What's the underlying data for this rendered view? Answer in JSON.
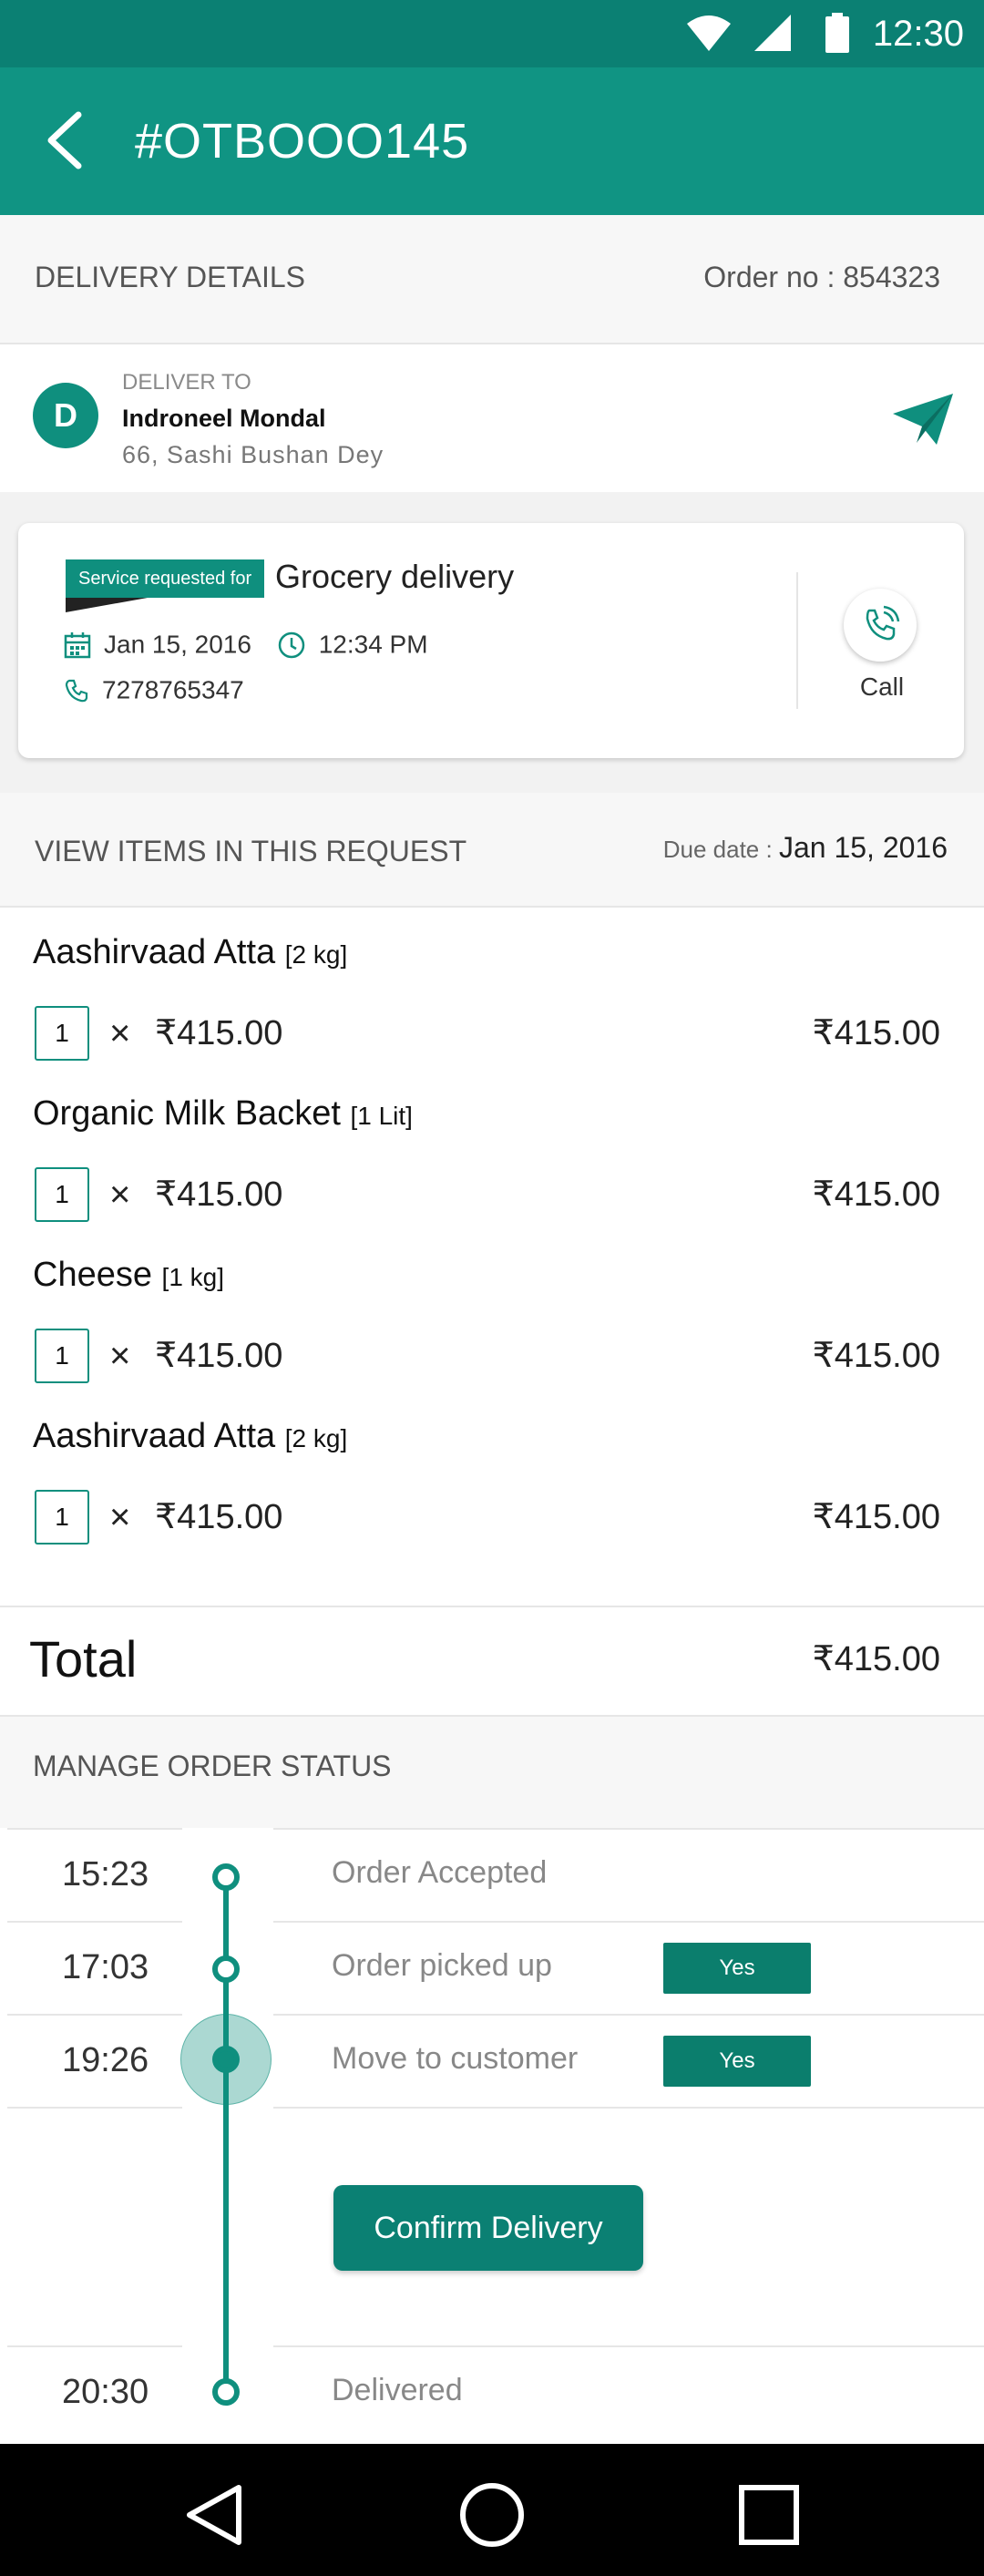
{
  "status_bar": {
    "time": "12:30"
  },
  "app_bar": {
    "title": "#OTBOOO145"
  },
  "delivery_section": {
    "title": "DELIVERY DETAILS",
    "order_no": "Order no : 854323"
  },
  "deliver_to": {
    "label": "DELIVER TO",
    "avatar_letter": "D",
    "name": "Indroneel Mondal",
    "address": "66, Sashi Bushan Dey"
  },
  "service_card": {
    "tag": "Service requested for",
    "service": "Grocery delivery",
    "date": "Jan 15, 2016",
    "time": "12:34 PM",
    "phone": "7278765347",
    "call_label": "Call"
  },
  "items_section": {
    "title": "VIEW ITEMS IN THIS REQUEST",
    "due_label": "Due date :",
    "due_date": "Jan 15, 2016"
  },
  "items": [
    {
      "name": "Aashirvaad Atta",
      "size": "[2 kg]",
      "qty": "1",
      "times": "×",
      "unit_price": "₹415.00",
      "subtotal": "₹415.00"
    },
    {
      "name": "Organic Milk Backet",
      "size": "[1 Lit]",
      "qty": "1",
      "times": "×",
      "unit_price": "₹415.00",
      "subtotal": "₹415.00"
    },
    {
      "name": "Cheese",
      "size": "[1 kg]",
      "qty": "1",
      "times": "×",
      "unit_price": "₹415.00",
      "subtotal": "₹415.00"
    },
    {
      "name": "Aashirvaad Atta",
      "size": "[2 kg]",
      "qty": "1",
      "times": "×",
      "unit_price": "₹415.00",
      "subtotal": "₹415.00"
    }
  ],
  "total": {
    "label": "Total",
    "value": "₹415.00"
  },
  "order_status": {
    "title": "MANAGE ORDER STATUS",
    "steps": [
      {
        "time": "15:23",
        "label": "Order Accepted"
      },
      {
        "time": "17:03",
        "label": "Order picked up",
        "toggle": "Yes"
      },
      {
        "time": "19:26",
        "label": "Move to customer",
        "toggle": "Yes"
      },
      {
        "time": "20:30",
        "label": "Delivered"
      }
    ],
    "confirm_button": "Confirm Delivery"
  },
  "colors": {
    "primary": "#109483",
    "primary_dark": "#0b8073",
    "accent": "#0f8f7e"
  },
  "icons": [
    "wifi-icon",
    "signal-icon",
    "battery-icon",
    "back-arrow-icon",
    "send-icon",
    "calendar-icon",
    "clock-icon",
    "phone-icon",
    "nav-back-icon",
    "nav-home-icon",
    "nav-recents-icon"
  ]
}
